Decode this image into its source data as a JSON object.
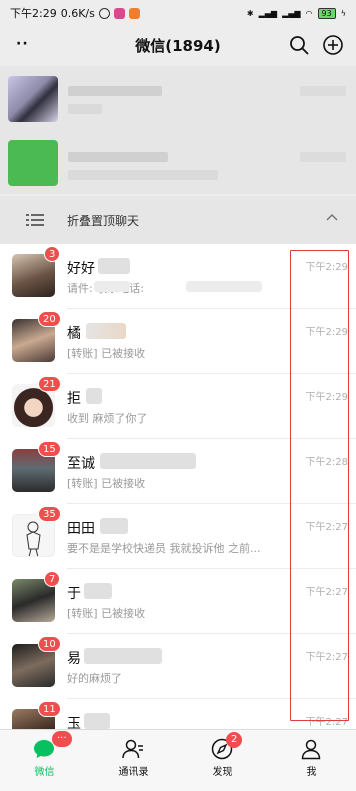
{
  "status_bar": {
    "time": "下午2:29",
    "speed": "0.6K/s",
    "battery": "93"
  },
  "header": {
    "title": "微信(1894)"
  },
  "fold": {
    "label": "折叠置顶聊天"
  },
  "chats": [
    {
      "name": "好好",
      "badge": "3",
      "message": "请件: 联系电话:",
      "time": "下午2:29"
    },
    {
      "name": "橘",
      "badge": "20",
      "message": "[转账] 已被接收",
      "time": "下午2:29"
    },
    {
      "name": "拒",
      "badge": "21",
      "message": "收到 麻烦了你了",
      "time": "下午2:29"
    },
    {
      "name": "至诚",
      "badge": "15",
      "message": "[转账] 已被接收",
      "time": "下午2:28"
    },
    {
      "name": "田田",
      "badge": "35",
      "message": "要不是是学校快递员 我就投诉他 之前...",
      "time": "下午2:27"
    },
    {
      "name": "于",
      "badge": "7",
      "message": "[转账] 已被接收",
      "time": "下午2:27"
    },
    {
      "name": "易",
      "badge": "10",
      "message": "好的麻烦了",
      "time": "下午2:27"
    },
    {
      "name": "玉",
      "badge": "11",
      "message": "",
      "time": "下午2:27"
    }
  ],
  "tabs": [
    {
      "label": "微信",
      "badge": "···",
      "icon": "chat-icon"
    },
    {
      "label": "通讯录",
      "icon": "contacts-icon"
    },
    {
      "label": "发现",
      "badge": "2",
      "icon": "compass-icon"
    },
    {
      "label": "我",
      "icon": "me-icon"
    }
  ],
  "colors": {
    "accent": "#07c160",
    "badge": "#f04e4e",
    "highlight_box": "#e23b3b"
  }
}
